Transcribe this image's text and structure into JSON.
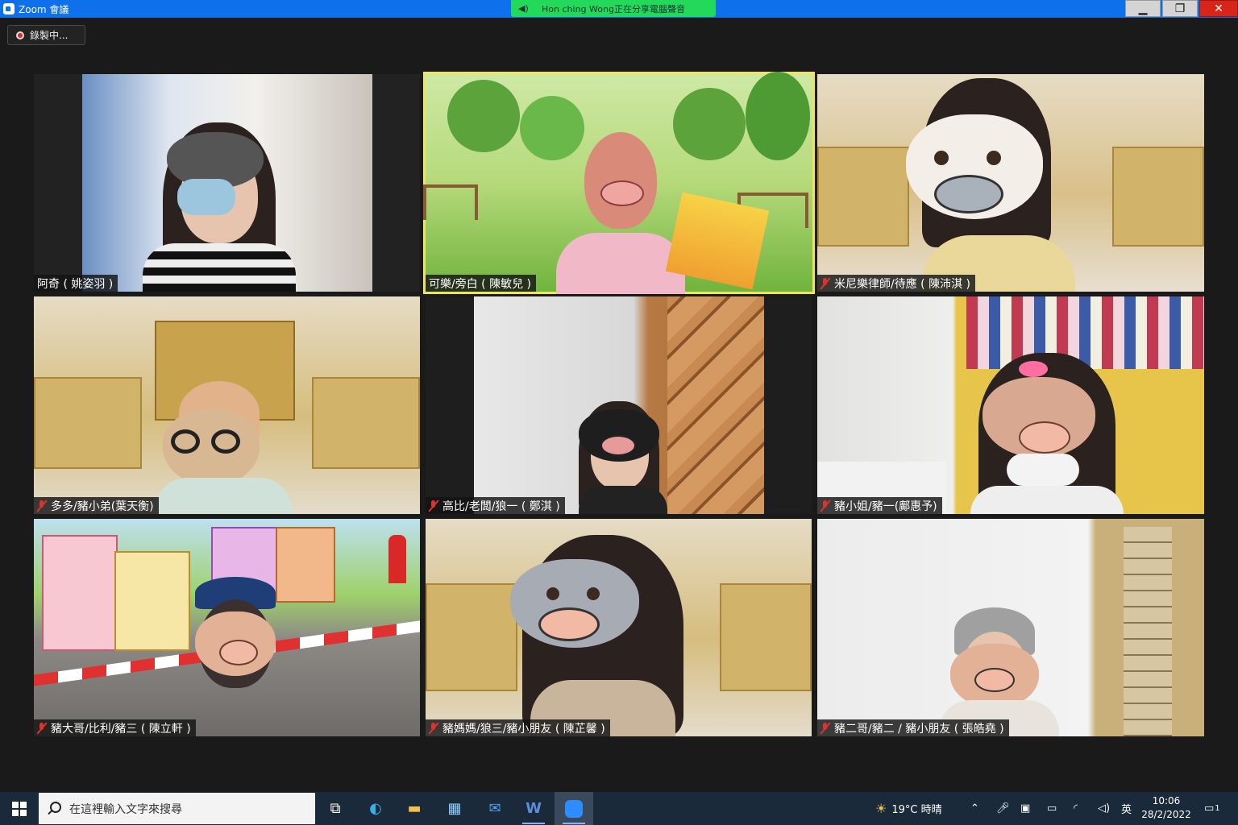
{
  "window": {
    "title": "Zoom 會議",
    "share_banner": "Hon ching Wong正在分享電腦聲音",
    "recording_label": "錄製中..."
  },
  "participants": [
    {
      "name": "阿奇 ( 姚姿羽 )",
      "muted": false
    },
    {
      "name": "可樂/旁白 ( 陳敏兒 )",
      "muted": false,
      "active_speaker": true
    },
    {
      "name": "米尼樂律師/待應 ( 陳沛淇 )",
      "muted": true
    },
    {
      "name": "多多/豬小弟(葉天衡)",
      "muted": true
    },
    {
      "name": "高比/老闆/狼一 ( 鄭淇 )",
      "muted": true
    },
    {
      "name": "豬小姐/豬一(鄺惠予)",
      "muted": true
    },
    {
      "name": "豬大哥/比利/豬三 ( 陳立軒 )",
      "muted": true
    },
    {
      "name": "豬媽媽/狼三/豬小朋友 ( 陳芷馨 )",
      "muted": true
    },
    {
      "name": "豬二哥/豬二 / 豬小朋友 ( 張皓堯 )",
      "muted": true
    }
  ],
  "taskbar": {
    "search_placeholder": "在這裡輸入文字來搜尋",
    "weather": "19°C 時晴",
    "ime": "英",
    "time": "10:06",
    "date": "28/2/2022",
    "notification_count": "1"
  }
}
